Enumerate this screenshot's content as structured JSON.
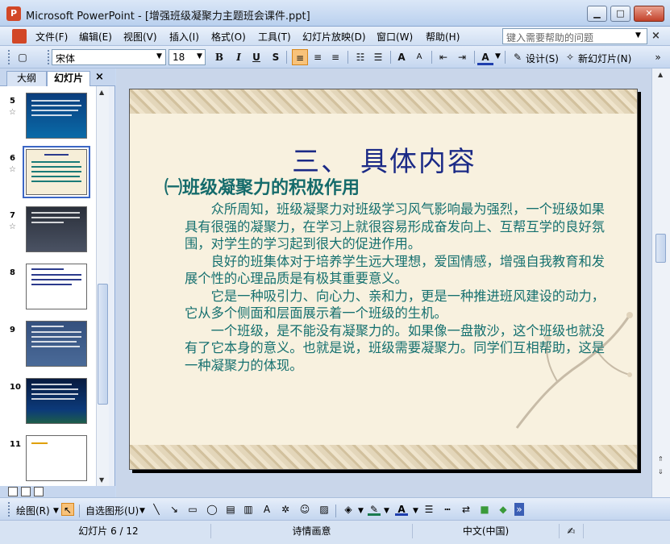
{
  "window": {
    "title": "Microsoft PowerPoint - [增强班级凝聚力主题班会课件.ppt]",
    "icon": "powerpoint-icon",
    "controls": {
      "minimize": "▁",
      "maximize": "□",
      "close": "✕"
    }
  },
  "menubar": {
    "items": [
      "文件(F)",
      "编辑(E)",
      "视图(V)",
      "插入(I)",
      "格式(O)",
      "工具(T)",
      "幻灯片放映(D)",
      "窗口(W)",
      "帮助(H)"
    ],
    "help_placeholder": "键入需要帮助的问题",
    "close_glyph": "×"
  },
  "toolbar": {
    "font_name": "宋体",
    "font_size": "18",
    "bold": "B",
    "italic": "I",
    "underline": "U",
    "shadow": "S",
    "grow_font": "A",
    "shrink_font": "A",
    "font_color": "A",
    "design_label": "设计(S)",
    "new_slide_label": "新幻灯片(N)"
  },
  "left_pane": {
    "tabs": [
      "大纲",
      "幻灯片"
    ],
    "active_tab": "幻灯片",
    "close_glyph": "×",
    "thumbnails": [
      {
        "number": "5",
        "star": "☆",
        "theme": "dark-blue"
      },
      {
        "number": "6",
        "star": "☆",
        "theme": "cream",
        "selected": true
      },
      {
        "number": "7",
        "star": "☆",
        "theme": "dark-gray"
      },
      {
        "number": "8",
        "star": "",
        "theme": "white"
      },
      {
        "number": "9",
        "star": "",
        "theme": "slate-blue"
      },
      {
        "number": "10",
        "star": "",
        "theme": "night-blue"
      },
      {
        "number": "11",
        "star": "",
        "theme": "white"
      }
    ]
  },
  "slide": {
    "title": "三、 具体内容",
    "subtitle": "㈠班级凝聚力的积极作用",
    "paragraphs": [
      "众所周知，班级凝聚力对班级学习风气影响最为强烈，一个班级如果具有很强的凝聚力，在学习上就很容易形成奋发向上、互帮互学的良好氛围，对学生的学习起到很大的促进作用。",
      "良好的班集体对于培养学生远大理想，爱国情感，增强自我教育和发展个性的心理品质是有极其重要意义。",
      "它是一种吸引力、向心力、亲和力，更是一种推进班风建设的动力，它从多个侧面和层面展示着一个班级的生机。",
      "一个班级，是不能没有凝聚力的。如果像一盘散沙，这个班级也就没有了它本身的意义。也就是说，班级需要凝聚力。同学们互相帮助，这是一种凝聚力的体现。"
    ]
  },
  "drawbar": {
    "draw_label": "绘图(R)",
    "autoshapes_label": "自选图形(U)"
  },
  "statusbar": {
    "slide_info": "幻灯片 6 / 12",
    "theme_name": "诗情画意",
    "language": "中文(中国)"
  },
  "colors": {
    "title": "#1b2a86",
    "body": "#15706f",
    "slide_bg": "#f8f1df",
    "chrome": "#c9daf3"
  }
}
